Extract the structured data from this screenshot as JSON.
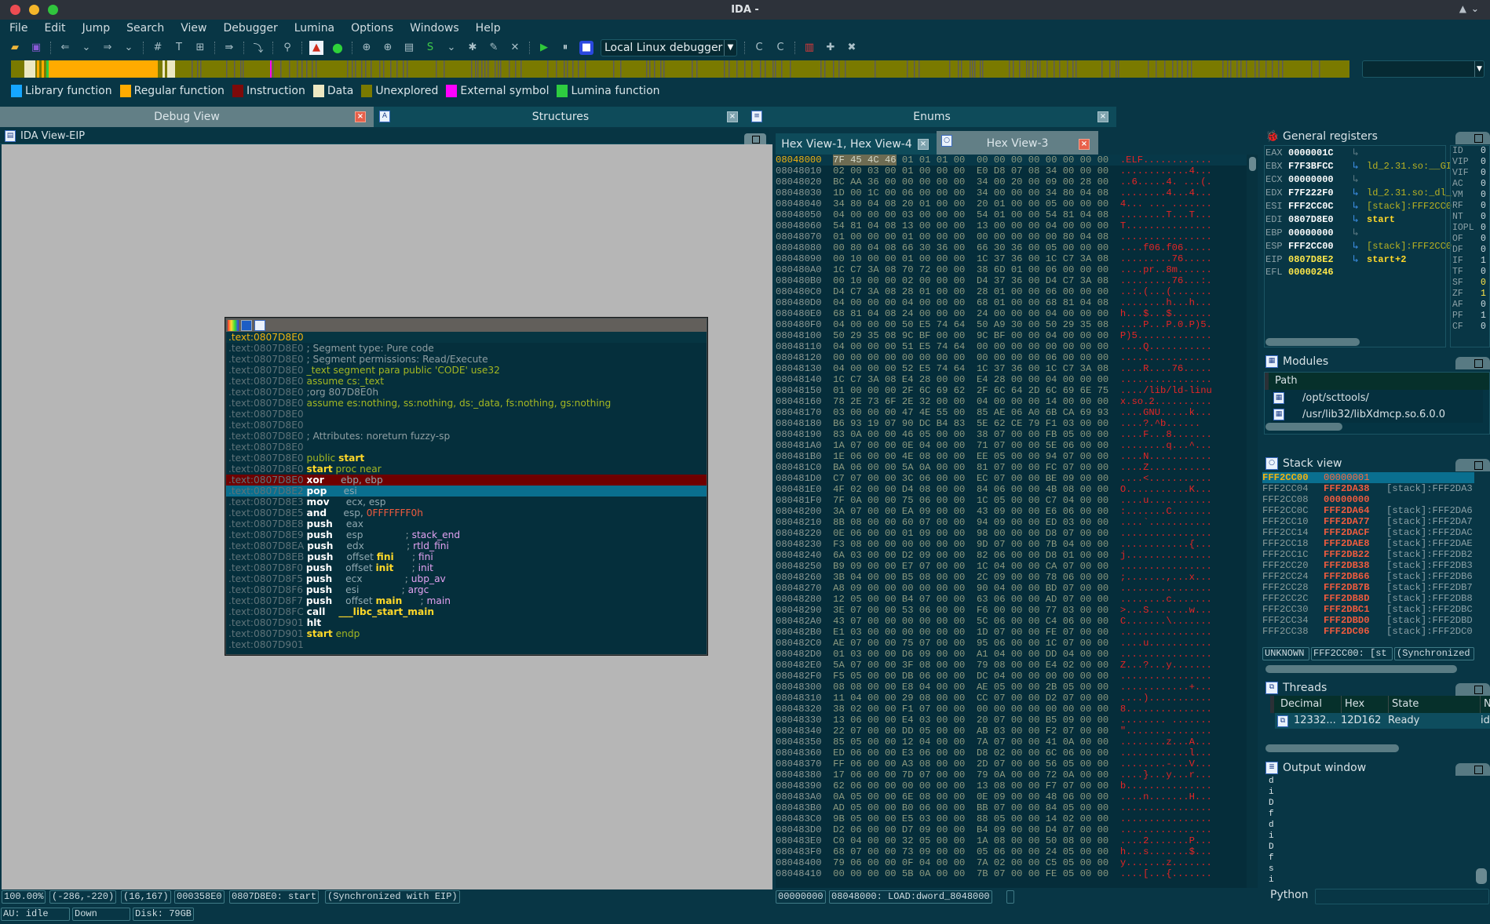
{
  "window": {
    "title": "IDA -"
  },
  "menu": [
    "File",
    "Edit",
    "Jump",
    "Search",
    "View",
    "Debugger",
    "Lumina",
    "Options",
    "Windows",
    "Help"
  ],
  "toolbar": {
    "debugger_select": "Local Linux debugger"
  },
  "colors": {
    "library": "#15a6ff",
    "regular": "#ffab00",
    "instruction": "#7d0a0a",
    "data": "#ede8c2",
    "unexplored": "#7a7a00",
    "external": "#ff00ff",
    "lumina": "#2ecc40"
  },
  "legend": [
    {
      "label": "Library function",
      "color": "#15a6ff"
    },
    {
      "label": "Regular function",
      "color": "#ffab00"
    },
    {
      "label": "Instruction",
      "color": "#7d0a0a"
    },
    {
      "label": "Data",
      "color": "#ede8c2"
    },
    {
      "label": "Unexplored",
      "color": "#7a7a00"
    },
    {
      "label": "External symbol",
      "color": "#ff00ff"
    },
    {
      "label": "Lumina function",
      "color": "#2ecc40"
    }
  ],
  "tabs": {
    "debug_view": "Debug View",
    "structures": "Structures",
    "enums": "Enums",
    "ida_view": "IDA View-EIP",
    "hex_1_4": "Hex View-1, Hex View-4",
    "hex_3": "Hex View-3"
  },
  "disasm": [
    {
      "addr": ".text:0807D8E0",
      "type": "first",
      "parts": []
    },
    {
      "addr": ".text:0807D8E0",
      "parts": [
        [
          "g",
          "; Segment type: Pure code"
        ]
      ]
    },
    {
      "addr": ".text:0807D8E0",
      "parts": [
        [
          "g",
          "; Segment permissions: Read/Execute"
        ]
      ]
    },
    {
      "addr": ".text:0807D8E0",
      "parts": [
        [
          "k",
          "_text segment para public 'CODE' use32"
        ]
      ]
    },
    {
      "addr": ".text:0807D8E0",
      "parts": [
        [
          "k",
          "assume cs:_text"
        ]
      ]
    },
    {
      "addr": ".text:0807D8E0",
      "parts": [
        [
          "g",
          ";org 807D8E0h"
        ]
      ]
    },
    {
      "addr": ".text:0807D8E0",
      "parts": [
        [
          "k",
          "assume es:nothing, ss:nothing, ds:_data, fs:nothing, gs:nothing"
        ]
      ]
    },
    {
      "addr": ".text:0807D8E0",
      "parts": []
    },
    {
      "addr": ".text:0807D8E0",
      "parts": []
    },
    {
      "addr": ".text:0807D8E0",
      "parts": [
        [
          "g",
          "; Attributes: noreturn fuzzy-sp"
        ]
      ]
    },
    {
      "addr": ".text:0807D8E0",
      "parts": []
    },
    {
      "addr": ".text:0807D8E0",
      "parts": [
        [
          "k",
          "public "
        ],
        [
          "n",
          "start"
        ]
      ]
    },
    {
      "addr": ".text:0807D8E0",
      "parts": [
        [
          "n",
          "start"
        ],
        [
          "k",
          " proc near"
        ]
      ]
    },
    {
      "addr": ".text:0807D8E0",
      "type": "hl-red",
      "parts": [
        [
          "m",
          "xor     "
        ],
        [
          "op",
          "ebp, ebp"
        ]
      ]
    },
    {
      "addr": ".text:0807D8E2",
      "type": "hl-blue",
      "parts": [
        [
          "m",
          "pop     "
        ],
        [
          "op",
          "esi"
        ]
      ]
    },
    {
      "addr": ".text:0807D8E3",
      "parts": [
        [
          "m",
          "mov     "
        ],
        [
          "op",
          "ecx, esp"
        ]
      ]
    },
    {
      "addr": ".text:0807D8E5",
      "parts": [
        [
          "m",
          "and     "
        ],
        [
          "op",
          "esp, "
        ],
        [
          "r",
          "0FFFFFFF0h"
        ]
      ]
    },
    {
      "addr": ".text:0807D8E8",
      "parts": [
        [
          "m",
          "push    "
        ],
        [
          "op",
          "eax"
        ]
      ]
    },
    {
      "addr": ".text:0807D8E9",
      "parts": [
        [
          "m",
          "push    "
        ],
        [
          "op",
          "esp              "
        ],
        [
          "g",
          "; "
        ],
        [
          "c",
          "stack_end"
        ]
      ]
    },
    {
      "addr": ".text:0807D8EA",
      "parts": [
        [
          "m",
          "push    "
        ],
        [
          "op",
          "edx              "
        ],
        [
          "g",
          "; "
        ],
        [
          "c",
          "rtld_fini"
        ]
      ]
    },
    {
      "addr": ".text:0807D8EB",
      "parts": [
        [
          "m",
          "push    "
        ],
        [
          "op",
          "offset "
        ],
        [
          "n",
          "fini"
        ],
        [
          "op",
          "      "
        ],
        [
          "g",
          "; "
        ],
        [
          "c",
          "fini"
        ]
      ]
    },
    {
      "addr": ".text:0807D8F0",
      "parts": [
        [
          "m",
          "push    "
        ],
        [
          "op",
          "offset "
        ],
        [
          "n",
          "init"
        ],
        [
          "op",
          "      "
        ],
        [
          "g",
          "; "
        ],
        [
          "c",
          "init"
        ]
      ]
    },
    {
      "addr": ".text:0807D8F5",
      "parts": [
        [
          "m",
          "push    "
        ],
        [
          "op",
          "ecx              "
        ],
        [
          "g",
          "; "
        ],
        [
          "c",
          "ubp_av"
        ]
      ]
    },
    {
      "addr": ".text:0807D8F6",
      "parts": [
        [
          "m",
          "push    "
        ],
        [
          "op",
          "esi              "
        ],
        [
          "g",
          "; "
        ],
        [
          "c",
          "argc"
        ]
      ]
    },
    {
      "addr": ".text:0807D8F7",
      "parts": [
        [
          "m",
          "push    "
        ],
        [
          "op",
          "offset "
        ],
        [
          "n",
          "main"
        ],
        [
          "op",
          "      "
        ],
        [
          "g",
          "; "
        ],
        [
          "c",
          "main"
        ]
      ]
    },
    {
      "addr": ".text:0807D8FC",
      "parts": [
        [
          "m",
          "call    "
        ],
        [
          "n",
          "___libc_start_main"
        ]
      ]
    },
    {
      "addr": ".text:0807D901",
      "parts": [
        [
          "m",
          "hlt"
        ]
      ]
    },
    {
      "addr": ".text:0807D901",
      "parts": [
        [
          "n",
          "start"
        ],
        [
          "k",
          " endp"
        ]
      ]
    },
    {
      "addr": ".text:0807D901",
      "parts": []
    }
  ],
  "ida_status": {
    "zoom": "100.00%",
    "graph_pos": "(-286,-220)",
    "mouse_pos": "(16,167)",
    "file_offset": "000358E0",
    "location": "0807D8E0: start",
    "sync": "(Synchronized with EIP)"
  },
  "au_status": {
    "au": "AU:  idle",
    "dir": "Down",
    "disk": "Disk: 79GB"
  },
  "hex": [
    [
      "08048000",
      "7F 45 4C 46 01 01 01 00  00 00 00 00 00 00 00 00",
      ".ELF............"
    ],
    [
      "08048010",
      "02 00 03 00 01 00 00 00  E0 D8 07 08 34 00 00 00",
      "............4..."
    ],
    [
      "08048020",
      "BC AA 36 00 00 00 00 00  34 00 20 00 09 00 28 00",
      "..6.....4. ...(."
    ],
    [
      "08048030",
      "1D 00 1C 00 06 00 00 00  34 00 00 00 34 80 04 08",
      "........4...4..."
    ],
    [
      "08048040",
      "34 80 04 08 20 01 00 00  20 01 00 00 05 00 00 00",
      "4... ... ......."
    ],
    [
      "08048050",
      "04 00 00 00 03 00 00 00  54 01 00 00 54 81 04 08",
      "........T...T..."
    ],
    [
      "08048060",
      "54 81 04 08 13 00 00 00  13 00 00 00 04 00 00 00",
      "T..............."
    ],
    [
      "08048070",
      "01 00 00 00 01 00 00 00  00 00 00 00 00 80 04 08",
      "................"
    ],
    [
      "08048080",
      "00 80 04 08 66 30 36 00  66 30 36 00 05 00 00 00",
      "....f06.f06....."
    ],
    [
      "08048090",
      "00 10 00 00 01 00 00 00  1C 37 36 00 1C C7 3A 08",
      ".........76....."
    ],
    [
      "080480A0",
      "1C C7 3A 08 70 72 00 00  38 6D 01 00 06 00 00 00",
      "....pr..8m......"
    ],
    [
      "080480B0",
      "00 10 00 00 02 00 00 00  D4 37 36 00 D4 C7 3A 08",
      ".........76...:."
    ],
    [
      "080480C0",
      "D4 C7 3A 08 28 01 00 00  28 01 00 00 06 00 00 00",
      "..:.(...(......."
    ],
    [
      "080480D0",
      "04 00 00 00 04 00 00 00  68 01 00 00 68 81 04 08",
      "........h...h..."
    ],
    [
      "080480E0",
      "68 81 04 08 24 00 00 00  24 00 00 00 04 00 00 00",
      "h...$...$......."
    ],
    [
      "080480F0",
      "04 00 00 00 50 E5 74 64  50 A9 30 00 50 29 35 08",
      "....P...P.0.P)5."
    ],
    [
      "08048100",
      "50 29 35 08 9C BF 00 00  9C BF 00 00 04 00 00 00",
      "P)5............."
    ],
    [
      "08048110",
      "04 00 00 00 51 E5 74 64  00 00 00 00 00 00 00 00",
      "....Q..........."
    ],
    [
      "08048120",
      "00 00 00 00 00 00 00 00  00 00 00 00 06 00 00 00",
      "................"
    ],
    [
      "08048130",
      "04 00 00 00 52 E5 74 64  1C 37 36 00 1C C7 3A 08",
      "....R....76....."
    ],
    [
      "08048140",
      "1C C7 3A 08 E4 28 00 00  E4 28 00 00 04 00 00 00",
      "................"
    ],
    [
      "08048150",
      "01 00 00 00 2F 6C 69 62  2F 6C 64 2D 6C 69 6E 75",
      "..../lib/ld-linu"
    ],
    [
      "08048160",
      "78 2E 73 6F 2E 32 00 00  04 00 00 00 14 00 00 00",
      "x.so.2.........."
    ],
    [
      "08048170",
      "03 00 00 00 47 4E 55 00  85 AE 06 A0 6B CA 69 93",
      "....GNU.....k..."
    ],
    [
      "08048180",
      "B6 93 19 07 90 DC B4 83  5E 62 CE 79 F1 03 00 00",
      "....?.^b......"
    ],
    [
      "08048190",
      "83 0A 00 00 46 05 00 00  38 07 00 00 FB 05 00 00",
      "....F...8......."
    ],
    [
      "080481A0",
      "1A 07 00 00 0E 04 00 00  71 07 00 00 5E 06 00 00",
      "........q...^..."
    ],
    [
      "080481B0",
      "1E 06 00 00 4E 08 00 00  EE 05 00 00 94 07 00 00",
      "....N..........."
    ],
    [
      "080481C0",
      "BA 06 00 00 5A 0A 00 00  81 07 00 00 FC 07 00 00",
      "....Z..........."
    ],
    [
      "080481D0",
      "C7 07 00 00 3C 06 00 00  EC 07 00 00 BE 09 00 00",
      "....<..........."
    ],
    [
      "080481E0",
      "4F 02 00 00 D4 08 00 00  84 06 00 00 4B 08 00 00",
      "O...........K..."
    ],
    [
      "080481F0",
      "7F 0A 00 00 75 06 00 00  1C 05 00 00 C7 04 00 00",
      "....u..........."
    ],
    [
      "08048200",
      "3A 07 00 00 EA 09 00 00  43 09 00 00 E6 06 00 00",
      ":.......C......."
    ],
    [
      "08048210",
      "8B 08 00 00 60 07 00 00  94 09 00 00 ED 03 00 00",
      "....`..........."
    ],
    [
      "08048220",
      "0E 06 00 00 01 09 00 00  98 00 00 00 D8 07 00 00",
      "................"
    ],
    [
      "08048230",
      "F3 08 00 00 00 00 00 00  9D 07 00 00 7B 04 00 00",
      "............{..."
    ],
    [
      "08048240",
      "6A 03 00 00 D2 09 00 00  82 06 00 00 D8 01 00 00",
      "j..............."
    ],
    [
      "08048250",
      "B9 09 00 00 E7 07 00 00  1C 04 00 00 CA 07 00 00",
      "................"
    ],
    [
      "08048260",
      "3B 04 00 00 B5 08 00 00  2C 09 00 00 78 06 00 00",
      ";.......,...x..."
    ],
    [
      "08048270",
      "A8 09 00 00 00 00 00 00  90 04 00 00 BD 07 00 00",
      "................"
    ],
    [
      "08048280",
      "12 05 00 00 B4 07 00 00  63 06 00 00 AD 07 00 00",
      "........c......."
    ],
    [
      "08048290",
      "3E 07 00 00 53 06 00 00  F6 00 00 00 77 03 00 00",
      ">...S.......w..."
    ],
    [
      "080482A0",
      "43 07 00 00 00 00 00 00  5C 06 00 00 C4 06 00 00",
      "C.......\\......."
    ],
    [
      "080482B0",
      "E1 03 00 00 00 00 00 00  1D 07 00 00 FE 07 00 00",
      "................"
    ],
    [
      "080482C0",
      "AE 07 00 00 75 07 00 00  95 06 00 00 1C 07 00 00",
      "....u..........."
    ],
    [
      "080482D0",
      "01 03 00 00 D6 09 00 00  A1 04 00 00 DD 04 00 00",
      "................"
    ],
    [
      "080482E0",
      "5A 07 00 00 3F 08 00 00  79 08 00 00 E4 02 00 00",
      "Z...?...y......."
    ],
    [
      "080482F0",
      "F5 05 00 00 DB 06 00 00  DC 04 00 00 00 00 00 00",
      "................"
    ],
    [
      "08048300",
      "08 08 00 00 E8 04 00 00  AE 05 00 00 2B 05 00 00",
      "............+..."
    ],
    [
      "08048310",
      "11 04 00 00 29 08 00 00  CC 07 00 00 D2 07 00 00",
      "....)..........."
    ],
    [
      "08048320",
      "38 02 00 00 F1 07 00 00  00 00 00 00 00 00 00 00",
      "8..............."
    ],
    [
      "08048330",
      "13 06 00 00 E4 03 00 00  20 07 00 00 B5 09 00 00",
      "........ ......."
    ],
    [
      "08048340",
      "22 07 00 00 DD 05 00 00  AB 03 00 00 F2 07 00 00",
      "\"..............."
    ],
    [
      "08048350",
      "85 05 00 00 12 04 00 00  7A 07 00 00 41 0A 00 00",
      "........z...A..."
    ],
    [
      "08048360",
      "ED 06 00 00 E3 06 00 00  D8 02 00 00 6C 06 00 00",
      "............l..."
    ],
    [
      "08048370",
      "FF 06 00 00 A3 08 00 00  2D 07 00 00 56 05 00 00",
      "........-...V..."
    ],
    [
      "08048380",
      "17 06 00 00 7D 07 00 00  79 0A 00 00 72 0A 00 00",
      "....}...y...r..."
    ],
    [
      "08048390",
      "62 06 00 00 00 00 00 00  13 08 00 00 F7 07 00 00",
      "b..............."
    ],
    [
      "080483A0",
      "0A 05 00 00 6E 08 00 00  0E 09 00 00 48 06 00 00",
      "....n.......H..."
    ],
    [
      "080483B0",
      "AD 05 00 00 B0 06 00 00  BB 07 00 00 84 05 00 00",
      "................"
    ],
    [
      "080483C0",
      "9B 05 00 00 E5 03 00 00  88 05 00 00 14 02 00 00",
      "................"
    ],
    [
      "080483D0",
      "D2 06 00 00 D7 09 00 00  B4 09 00 00 D4 07 00 00",
      "................"
    ],
    [
      "080483E0",
      "C0 04 00 00 32 05 00 00  1A 08 00 00 50 08 00 00",
      "....2.......P..."
    ],
    [
      "080483F0",
      "68 07 00 00 73 09 00 00  05 06 00 00 24 05 00 00",
      "h...s.......$..."
    ],
    [
      "08048400",
      "79 06 00 00 0F 04 00 00  7A 02 00 00 C5 05 00 00",
      "y.......z......."
    ],
    [
      "08048410",
      "00 00 00 00 5B 0A 00 00  7B 07 00 00 FE 05 00 00",
      "....[...{......."
    ]
  ],
  "hex_status": {
    "offset": "00000000",
    "location": "08048000: LOAD:dword_8048000"
  },
  "registers": {
    "title": "General registers",
    "list": [
      {
        "name": "EAX",
        "value": "0000001C",
        "ref": "",
        "arrow": "gray"
      },
      {
        "name": "EBX",
        "value": "F7F3BFCC",
        "ref": "ld_2.31.so:__GI",
        "arrow": "blue"
      },
      {
        "name": "ECX",
        "value": "00000000",
        "ref": "",
        "arrow": "gray"
      },
      {
        "name": "EDX",
        "value": "F7F222F0",
        "ref": "ld_2.31.so:_dl_",
        "arrow": "blue"
      },
      {
        "name": "ESI",
        "value": "FFF2CC0C",
        "ref": "[stack]:FFF2CC0",
        "arrow": "blue"
      },
      {
        "name": "EDI",
        "value": "0807D8E0",
        "ref": "start",
        "arrow": "blue",
        "ref_hl": true
      },
      {
        "name": "EBP",
        "value": "00000000",
        "ref": "",
        "arrow": "gray"
      },
      {
        "name": "ESP",
        "value": "FFF2CC00",
        "ref": "[stack]:FFF2CC0",
        "arrow": "blue"
      },
      {
        "name": "EIP",
        "value": "0807D8E2",
        "ref": "start+2",
        "arrow": "blue",
        "ref_hl": true,
        "changed": true
      },
      {
        "name": "EFL",
        "value": "00000246",
        "ref": "",
        "arrow": "none",
        "changed": true
      }
    ],
    "flags": [
      {
        "name": "ID",
        "value": "0"
      },
      {
        "name": "VIP",
        "value": "0"
      },
      {
        "name": "VIF",
        "value": "0"
      },
      {
        "name": "AC",
        "value": "0"
      },
      {
        "name": "VM",
        "value": "0"
      },
      {
        "name": "RF",
        "value": "0"
      },
      {
        "name": "NT",
        "value": "0"
      },
      {
        "name": "IOPL",
        "value": "0"
      },
      {
        "name": "OF",
        "value": "0"
      },
      {
        "name": "DF",
        "value": "0"
      },
      {
        "name": "IF",
        "value": "1"
      },
      {
        "name": "TF",
        "value": "0"
      },
      {
        "name": "SF",
        "value": "0",
        "changed": true
      },
      {
        "name": "ZF",
        "value": "1",
        "changed": true
      },
      {
        "name": "AF",
        "value": "0"
      },
      {
        "name": "PF",
        "value": "1"
      },
      {
        "name": "CF",
        "value": "0"
      }
    ]
  },
  "modules": {
    "title": "Modules",
    "column": "Path",
    "items": [
      "/opt/scttools/",
      "/usr/lib32/libXdmcp.so.6.0.0"
    ]
  },
  "stack": {
    "title": "Stack view",
    "rows": [
      [
        "FFF2CC00",
        "00000001",
        ""
      ],
      [
        "FFF2CC04",
        "FFF2DA38",
        "[stack]:FFF2DA3"
      ],
      [
        "FFF2CC08",
        "00000000",
        ""
      ],
      [
        "FFF2CC0C",
        "FFF2DA64",
        "[stack]:FFF2DA6"
      ],
      [
        "FFF2CC10",
        "FFF2DA77",
        "[stack]:FFF2DA7"
      ],
      [
        "FFF2CC14",
        "FFF2DACF",
        "[stack]:FFF2DAC"
      ],
      [
        "FFF2CC18",
        "FFF2DAE8",
        "[stack]:FFF2DAE"
      ],
      [
        "FFF2CC1C",
        "FFF2DB22",
        "[stack]:FFF2DB2"
      ],
      [
        "FFF2CC20",
        "FFF2DB38",
        "[stack]:FFF2DB3"
      ],
      [
        "FFF2CC24",
        "FFF2DB66",
        "[stack]:FFF2DB6"
      ],
      [
        "FFF2CC28",
        "FFF2DB7B",
        "[stack]:FFF2DB7"
      ],
      [
        "FFF2CC2C",
        "FFF2DB8D",
        "[stack]:FFF2DB8"
      ],
      [
        "FFF2CC30",
        "FFF2DBC1",
        "[stack]:FFF2DBC"
      ],
      [
        "FFF2CC34",
        "FFF2DBD0",
        "[stack]:FFF2DBD"
      ],
      [
        "FFF2CC38",
        "FFF2DC06",
        "[stack]:FFF2DC0"
      ]
    ],
    "status": [
      "UNKNOWN",
      "FFF2CC00: [st",
      "(Synchronized"
    ]
  },
  "threads": {
    "title": "Threads",
    "columns": [
      "Decimal",
      "Hex",
      "State",
      "Na"
    ],
    "rows": [
      [
        "12332...",
        "12D162",
        "Ready",
        "ida"
      ]
    ]
  },
  "output": {
    "title": "Output window",
    "lines": [
      "d",
      "i",
      "D",
      "f",
      "d",
      "i",
      "D",
      "f",
      "s",
      "i"
    ],
    "input_label": "Python"
  }
}
